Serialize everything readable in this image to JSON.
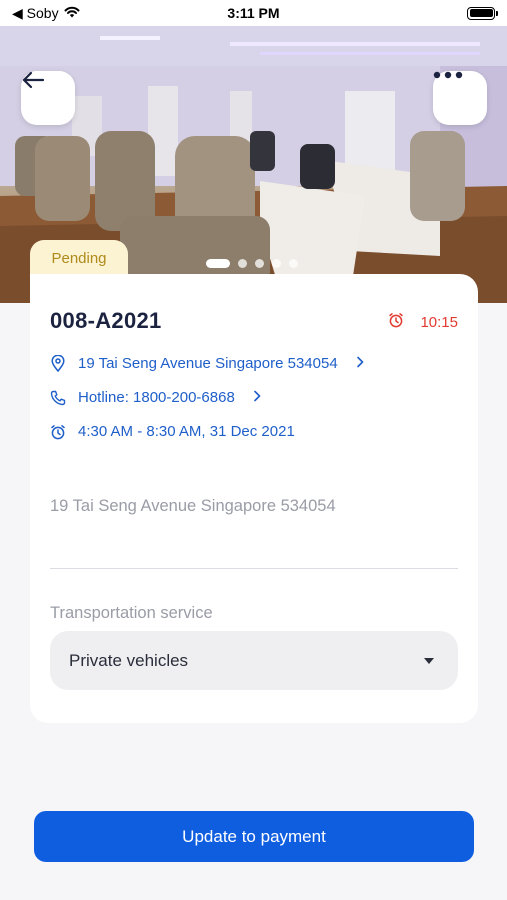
{
  "status_bar": {
    "carrier": "◀ Soby",
    "time": "3:11 PM"
  },
  "hero": {
    "image_alt": "Dialysis treatment room with reclining chairs and machines",
    "slide_count": 5,
    "active_slide": 1
  },
  "booking": {
    "status": "Pending",
    "id": "008-A2021",
    "timer": "10:15",
    "address_link": "19 Tai Seng Avenue Singapore 534054",
    "hotline": "Hotline: 1800-200-6868",
    "schedule": "4:30 AM - 8:30 AM, 31 Dec 2021",
    "address_text": "19 Tai Seng Avenue Singapore 534054"
  },
  "transport": {
    "label": "Transportation service",
    "selected": "Private vehicles"
  },
  "actions": {
    "primary_label": "Update to payment"
  },
  "colors": {
    "accent": "#0f5ee0",
    "link": "#1f5fc9",
    "timer": "#e23b32",
    "pending_bg": "#fbf3d2",
    "pending_text": "#b08a1c"
  },
  "icons": [
    "back-arrow-icon",
    "more-icon",
    "location-pin-icon",
    "phone-icon",
    "alarm-clock-icon",
    "chevron-right-icon",
    "dropdown-caret-icon",
    "wifi-icon",
    "battery-icon"
  ]
}
